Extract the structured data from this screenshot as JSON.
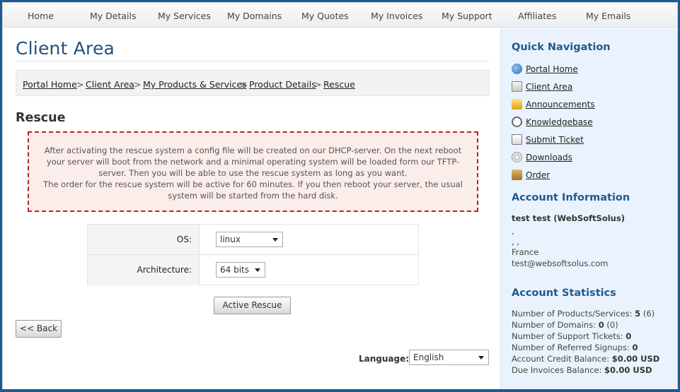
{
  "nav": {
    "items": [
      "Home",
      "My Details",
      "My Services",
      "My Domains",
      "My Quotes",
      "My Invoices",
      "My Support",
      "Affiliates",
      "My Emails"
    ]
  },
  "page": {
    "title": "Client Area",
    "section_title": "Rescue"
  },
  "breadcrumb": {
    "items": [
      "Portal Home",
      "Client Area",
      "My Products & Services",
      "Product Details",
      "Rescue"
    ],
    "separator": ">"
  },
  "notice": {
    "line1": "After activating the rescue system a config file will be created on our DHCP-server. On the next reboot your server will boot from the network and a minimal operating system will be loaded form our TFTP-server. Then you will be able to use the rescue system as long as you want.",
    "line2": "The order for the rescue system will be active for 60 minutes. If you then reboot your server, the usual system will be started from the hard disk."
  },
  "form": {
    "os_label": "OS:",
    "os_value": "linux",
    "arch_label": "Architecture:",
    "arch_value": "64 bits",
    "submit_label": "Active Rescue"
  },
  "back_label": "<< Back",
  "language": {
    "label": "Language:",
    "value": "English"
  },
  "sidebar": {
    "quick_nav_title": "Quick Navigation",
    "links": [
      "Portal Home",
      "Client Area",
      "Announcements",
      "Knowledgebase",
      "Submit Ticket",
      "Downloads",
      "Order"
    ],
    "link_icons": [
      "globe-icon",
      "home-icon",
      "announcement-icon",
      "magnifier-icon",
      "ticket-icon",
      "disc-icon",
      "box-icon"
    ],
    "account_info_title": "Account Information",
    "account_name": "test test (WebSoftSolus)",
    "account_line1": ",",
    "account_line2": ", ,",
    "account_country": "France",
    "account_email": "test@websoftsolus.com",
    "stats_title": "Account Statistics",
    "stats": [
      {
        "label": "Number of Products/Services:",
        "value": "5",
        "extra": "(6)"
      },
      {
        "label": "Number of Domains:",
        "value": "0",
        "extra": "(0)"
      },
      {
        "label": "Number of Support Tickets:",
        "value": "0",
        "extra": ""
      },
      {
        "label": "Number of Referred Signups:",
        "value": "0",
        "extra": ""
      },
      {
        "label": "Account Credit Balance:",
        "value": "$0.00 USD",
        "extra": ""
      },
      {
        "label": "Due Invoices Balance:",
        "value": "$0.00 USD",
        "extra": ""
      }
    ]
  },
  "colors": {
    "frame_blue": "#1f5a8e",
    "title_blue": "#23527c",
    "notice_border": "#b6222a",
    "notice_bg": "#fbeeea",
    "sidebar_bg": "#eaf3fd"
  }
}
